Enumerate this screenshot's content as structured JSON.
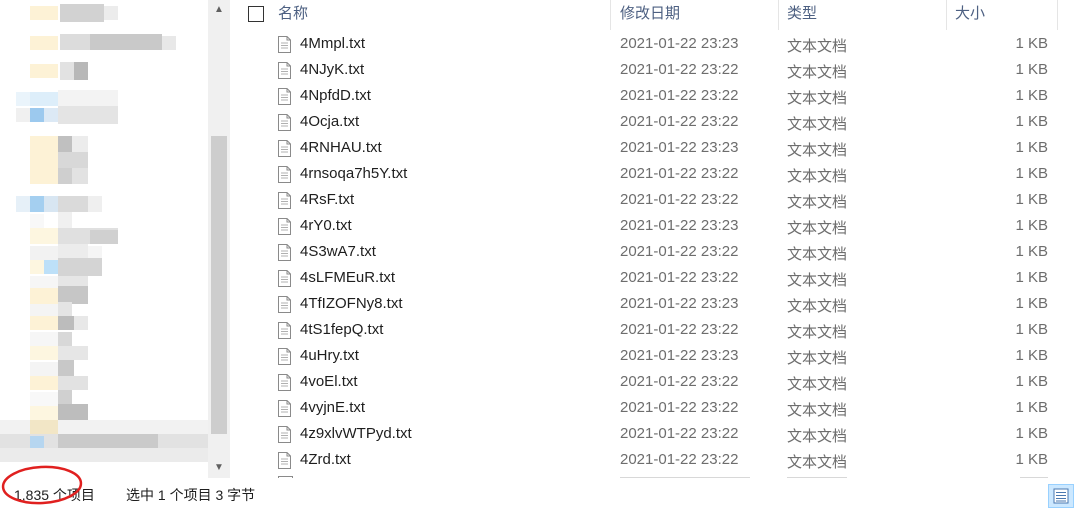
{
  "header": {
    "name": "名称",
    "date": "修改日期",
    "type": "类型",
    "size": "大小"
  },
  "files": [
    {
      "name": "4Mmpl.txt",
      "date": "2021-01-22 23:23",
      "type": "文本文档",
      "size": "1 KB"
    },
    {
      "name": "4NJyK.txt",
      "date": "2021-01-22 23:22",
      "type": "文本文档",
      "size": "1 KB"
    },
    {
      "name": "4NpfdD.txt",
      "date": "2021-01-22 23:22",
      "type": "文本文档",
      "size": "1 KB"
    },
    {
      "name": "4Ocja.txt",
      "date": "2021-01-22 23:22",
      "type": "文本文档",
      "size": "1 KB"
    },
    {
      "name": "4RNHAU.txt",
      "date": "2021-01-22 23:23",
      "type": "文本文档",
      "size": "1 KB"
    },
    {
      "name": "4rnsoqa7h5Y.txt",
      "date": "2021-01-22 23:22",
      "type": "文本文档",
      "size": "1 KB"
    },
    {
      "name": "4RsF.txt",
      "date": "2021-01-22 23:22",
      "type": "文本文档",
      "size": "1 KB"
    },
    {
      "name": "4rY0.txt",
      "date": "2021-01-22 23:23",
      "type": "文本文档",
      "size": "1 KB"
    },
    {
      "name": "4S3wA7.txt",
      "date": "2021-01-22 23:22",
      "type": "文本文档",
      "size": "1 KB"
    },
    {
      "name": "4sLFMEuR.txt",
      "date": "2021-01-22 23:22",
      "type": "文本文档",
      "size": "1 KB"
    },
    {
      "name": "4TfIZOFNy8.txt",
      "date": "2021-01-22 23:23",
      "type": "文本文档",
      "size": "1 KB"
    },
    {
      "name": "4tS1fepQ.txt",
      "date": "2021-01-22 23:22",
      "type": "文本文档",
      "size": "1 KB"
    },
    {
      "name": "4uHry.txt",
      "date": "2021-01-22 23:23",
      "type": "文本文档",
      "size": "1 KB"
    },
    {
      "name": "4voEl.txt",
      "date": "2021-01-22 23:22",
      "type": "文本文档",
      "size": "1 KB"
    },
    {
      "name": "4vyjnE.txt",
      "date": "2021-01-22 23:22",
      "type": "文本文档",
      "size": "1 KB"
    },
    {
      "name": "4z9xlvWTPyd.txt",
      "date": "2021-01-22 23:22",
      "type": "文本文档",
      "size": "1 KB"
    },
    {
      "name": "4Zrd.txt",
      "date": "2021-01-22 23:22",
      "type": "文本文档",
      "size": "1 KB"
    }
  ],
  "status": {
    "item_count": "1,835 个项目",
    "selection": "选中 1 个项目  3 字节"
  },
  "icons": {
    "file": "text-file-icon",
    "view": "details-view-icon",
    "scroll_up": "scroll-up-arrow-icon",
    "scroll_down": "scroll-down-arrow-icon"
  },
  "colors": {
    "header_text": "#4d6082",
    "secondary_text": "#6d6d6d",
    "highlight_circle": "#e0201f",
    "view_button": "#cce8ff"
  }
}
